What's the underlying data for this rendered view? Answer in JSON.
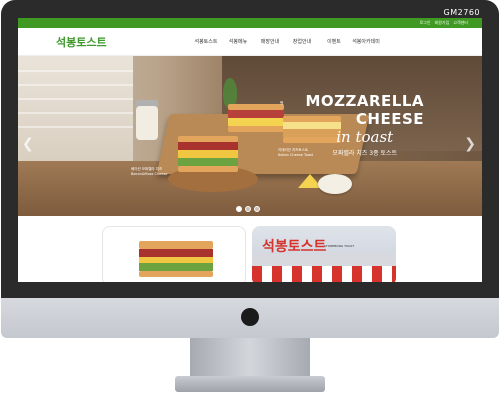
{
  "corner_tag": "GM2760",
  "util_links": [
    "로그인",
    "회원가입",
    "고객센터"
  ],
  "brand": {
    "logo_text": "석봉토스트",
    "accent_color": "#3f9922"
  },
  "nav": {
    "items": [
      "석봉토스트",
      "석봉메뉴",
      "매장안내",
      "창업안내",
      "이벤트",
      "석봉아카데미"
    ]
  },
  "hero": {
    "headline_1": "MOZZARELLA",
    "headline_2": "CHEESE",
    "headline_3": "in toast",
    "headline_4": "모짜렐라 치즈 3종 토스트",
    "caption_left_1": "베이컨 모짜렐라 치즈",
    "caption_left_2": "Bacon&Mozz Cheese",
    "caption_right_1": "이태리안 치즈토스트",
    "caption_right_2": "Italian Cheese Toast",
    "caption_top": "햄",
    "slide_count": 3,
    "active_slide": 1
  },
  "cards": {
    "store_name": "석봉토스트",
    "store_sub": "STONEBONG TOAST"
  },
  "icons": {
    "prev": "chevron-left-icon",
    "next": "chevron-right-icon"
  }
}
